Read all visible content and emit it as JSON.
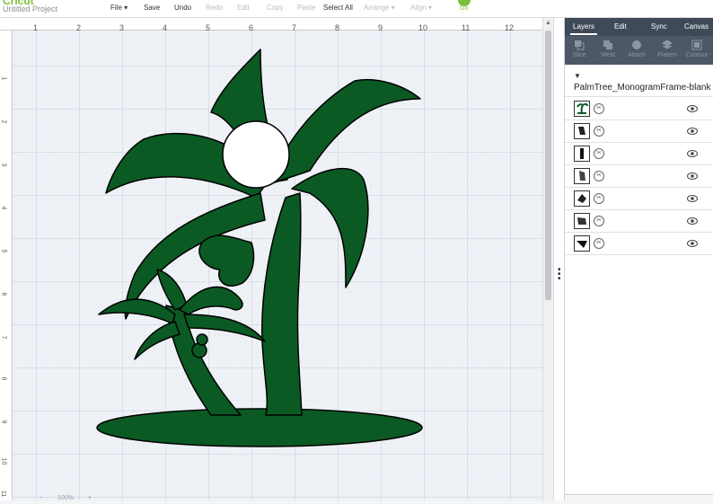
{
  "app": {
    "logo": "Cricut",
    "project_name": "Untitled Project"
  },
  "menu": {
    "file": "File ▾",
    "save": "Save",
    "undo": "Undo",
    "redo": "Redo",
    "edit": "Edit",
    "copy": "Copy",
    "paste": "Paste",
    "select_all": "Select All",
    "arrange": "Arrange ▾",
    "align": "Align ▾",
    "go": "Go"
  },
  "ruler": {
    "top": [
      "1",
      "2",
      "3",
      "4",
      "5",
      "6",
      "7",
      "8",
      "9",
      "10",
      "11",
      "12"
    ],
    "left": [
      "1",
      "2",
      "3",
      "4",
      "5",
      "6",
      "7",
      "8",
      "9",
      "10",
      "11"
    ]
  },
  "panel": {
    "tabs": [
      "Layers",
      "Edit",
      "Sync",
      "Canvas"
    ],
    "tools": [
      "Slice",
      "Weld",
      "Attach",
      "Flatten",
      "Contour"
    ],
    "group_name": "PalmTree_MonogramFrame-blank",
    "layer_count": 7
  },
  "zoom": {
    "level": "100%"
  },
  "colors": {
    "accent": "#7bbf3a",
    "design": "#0b5a24",
    "panel_dark": "#3e4a58"
  }
}
